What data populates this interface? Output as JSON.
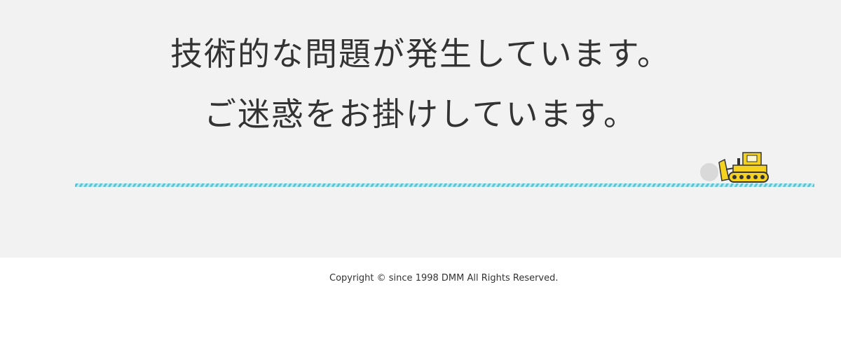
{
  "error": {
    "title_line_1": "技術的な問題が発生しています。",
    "title_line_2": "ご迷惑をお掛けしています。"
  },
  "illustration": {
    "icon": "bulldozer-icon",
    "boulder_icon": "boulder-icon",
    "colors": {
      "ground_stripe": "#5fc4d3",
      "ground_stripe_light": "#bfe8ef",
      "bulldozer_body": "#f5d21f",
      "boulder": "#d9d9d9"
    }
  },
  "footer": {
    "copyright": "Copyright © since 1998 DMM All Rights Reserved."
  },
  "colors": {
    "panel_background": "#f2f2f2",
    "page_background": "#ffffff",
    "text": "#333333"
  }
}
